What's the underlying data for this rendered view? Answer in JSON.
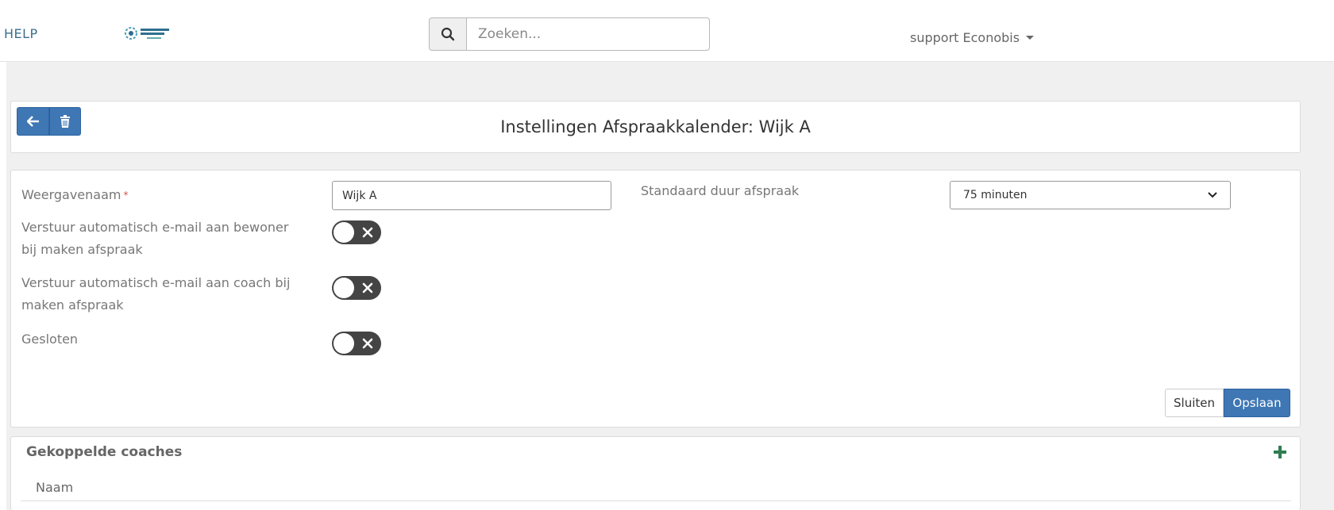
{
  "navbar": {
    "help_label": "HELP",
    "logo_text": "energie samen",
    "search_placeholder": "Zoeken...",
    "user_label": "support Econobis"
  },
  "header": {
    "title": "Instellingen Afspraakkalender: Wijk A",
    "back_icon": "arrow-left-icon",
    "delete_icon": "trash-icon"
  },
  "form": {
    "display_name_label": "Weergavenaam",
    "display_name_required": "*",
    "display_name_value": "Wijk A",
    "default_duration_label": "Standaard duur afspraak",
    "default_duration_value": "75 minuten",
    "email_resident_label": "Verstuur automatisch e-mail aan bewoner bij maken afspraak",
    "email_resident_on": false,
    "email_coach_label": "Verstuur automatisch e-mail aan coach bij maken afspraak",
    "email_coach_on": false,
    "closed_label": "Gesloten",
    "closed_on": false,
    "close_button": "Sluiten",
    "save_button": "Opslaan"
  },
  "coaches": {
    "title": "Gekoppelde coaches",
    "columns": [
      "Naam"
    ]
  },
  "colors": {
    "primary": "#3e77b4",
    "toggle_off": "#444444",
    "add_green": "#2e7d4f"
  }
}
